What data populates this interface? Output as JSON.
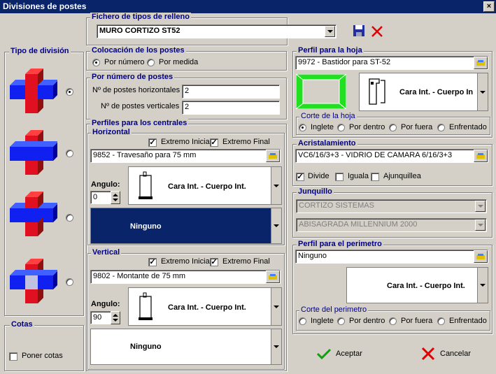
{
  "window": {
    "title": "Divisiones de postes",
    "close": "×"
  },
  "fichero": {
    "group": "Fichero de tipos de relleno",
    "value": "MURO CORTIZO ST52"
  },
  "tipo_division": {
    "group": "Tipo de división"
  },
  "cotas": {
    "group": "Cotas",
    "checkbox": "Poner cotas"
  },
  "colocacion": {
    "group": "Colocación de los postes",
    "opt1": "Por número",
    "opt2": "Por medida"
  },
  "por_numero": {
    "group": "Por número de postes",
    "horizontales_label": "Nº de postes horizontales",
    "horizontales_value": "2",
    "verticales_label": "Nº de postes verticales",
    "verticales_value": "2"
  },
  "perfiles_centrales": {
    "group": "Perfiles para los centrales",
    "horizontal": {
      "label": "Horizontal",
      "extremo_inicial": "Extremo Inicial",
      "extremo_final": "Extremo Final",
      "perfil": "9852 - Travesaño para 75 mm",
      "angulo_label": "Angulo:",
      "angulo_value": "0",
      "cara": "Cara Int. - Cuerpo Int.",
      "ninguno": "Ninguno"
    },
    "vertical": {
      "label": "Vertical",
      "extremo_inicial": "Extremo Inicial",
      "extremo_final": "Extremo Final",
      "perfil": "9802 - Montante de 75 mm",
      "angulo_label": "Angulo:",
      "angulo_value": "90",
      "cara": "Cara Int. - Cuerpo Int.",
      "ninguno": "Ninguno"
    }
  },
  "perfil_hoja": {
    "group": "Perfil para la hoja",
    "value": "9972 - Bastidor para ST-52",
    "cara": "Cara Int. - Cuerpo In",
    "corte_group": "Corte de la hoja",
    "opts": [
      "Inglete",
      "Por dentro",
      "Por fuera",
      "Enfrentado"
    ]
  },
  "acristalamiento": {
    "group": "Acristalamiento",
    "value": "VC6/16/3+3 - VIDRIO DE CAMARA 6/16/3+3",
    "divide": "Divide",
    "iguala": "Iguala",
    "ajunquillea": "Ajunquillea"
  },
  "junquillo": {
    "group": "Junquillo",
    "value1": "CORTIZO SISTEMAS",
    "value2": "ABISAGRADA MILLENNIUM 2000"
  },
  "perimetro": {
    "group": "Perfil para el perimetro",
    "value": "Ninguno",
    "cara": "Cara Int. - Cuerpo Int.",
    "corte_group": "Corte del perimetro",
    "opts": [
      "Inglete",
      "Por dentro",
      "Por fuera",
      "Enfrentado"
    ]
  },
  "buttons": {
    "aceptar": "Aceptar",
    "cancelar": "Cancelar"
  },
  "colors": {
    "title_bar": "#0a246a",
    "group_label": "#000080",
    "selected_profile": "#0a246a",
    "post_red": "#e0101a",
    "post_blue": "#1010e0",
    "frame_green": "#20e020"
  }
}
